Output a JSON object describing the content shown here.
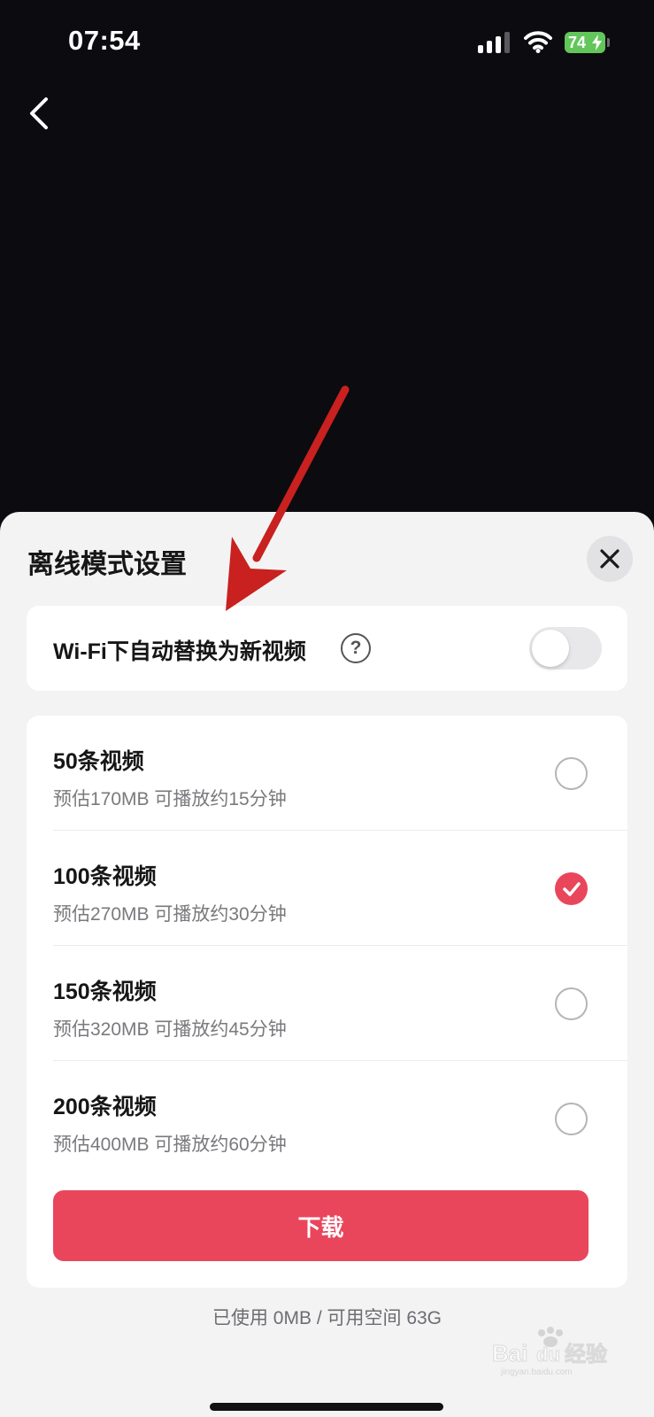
{
  "status_bar": {
    "time": "07:54",
    "battery_level": "74",
    "icons": [
      "signal-icon",
      "wifi-icon",
      "battery-charging-icon"
    ]
  },
  "nav": {
    "back_icon": "chevron-left-icon"
  },
  "sheet": {
    "title": "离线模式设置",
    "close_icon": "close-icon",
    "wifi_setting": {
      "label": "Wi-Fi下自动替换为新视频",
      "help_symbol": "?",
      "toggle_on": false
    },
    "options": [
      {
        "title": "50条视频",
        "subtitle": "预估170MB 可播放约15分钟",
        "selected": false
      },
      {
        "title": "100条视频",
        "subtitle": "预估270MB 可播放约30分钟",
        "selected": true
      },
      {
        "title": "150条视频",
        "subtitle": "预估320MB 可播放约45分钟",
        "selected": false
      },
      {
        "title": "200条视频",
        "subtitle": "预估400MB 可播放约60分钟",
        "selected": false
      }
    ],
    "download_label": "下载",
    "storage_info": "已使用 0MB / 可用空间 63G"
  },
  "watermark": {
    "text": "Bai经验",
    "sub": "jingyan.baidu.com"
  },
  "colors": {
    "background": "#0c0b10",
    "sheet": "#f3f3f4",
    "accent": "#e9465c",
    "battery": "#62c65a",
    "annotation_arrow": "#c8211f"
  }
}
